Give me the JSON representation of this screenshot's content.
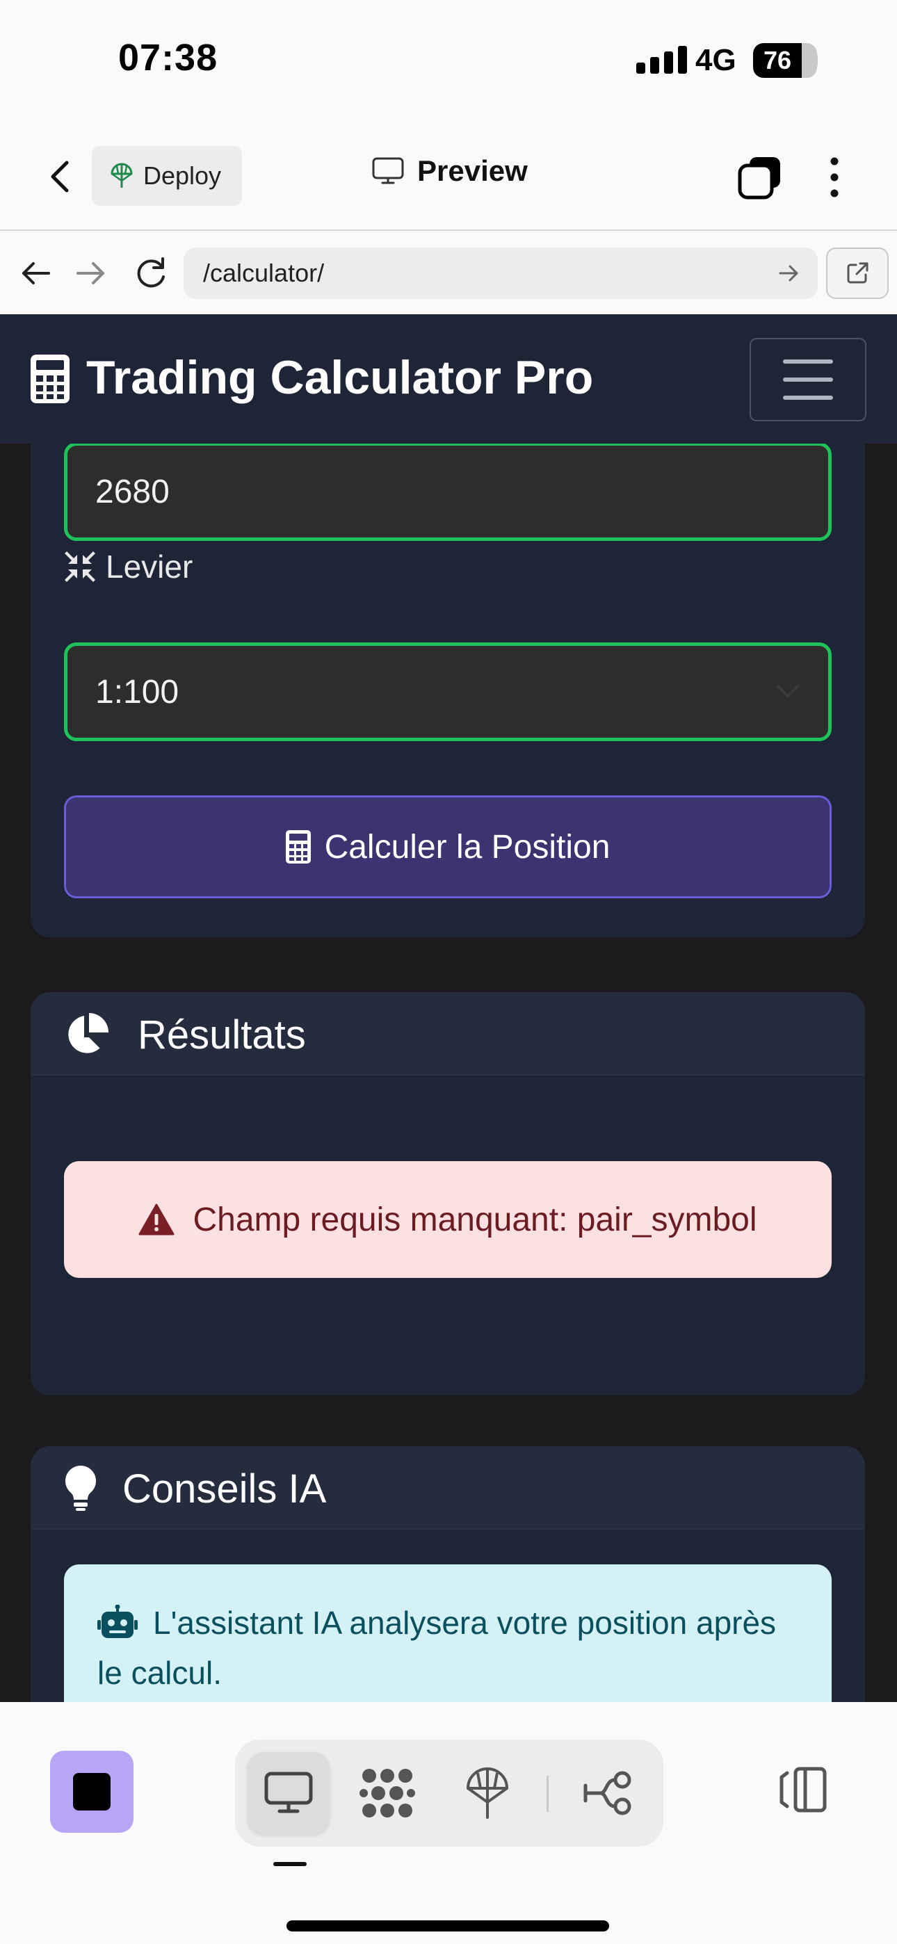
{
  "status_bar": {
    "time": "07:38",
    "network": "4G",
    "battery_percent": "76",
    "battery_level": 0.76
  },
  "app_header": {
    "deploy_label": "Deploy",
    "title": "Preview",
    "icons": [
      "back-chevron-icon",
      "deploy-icon",
      "monitor-icon",
      "tabs-icon",
      "more-vertical-icon"
    ]
  },
  "browser": {
    "url": "/calculator/",
    "icons": [
      "arrow-left-icon",
      "arrow-right-icon",
      "reload-icon",
      "arrow-right-icon",
      "open-external-icon"
    ]
  },
  "site": {
    "brand": "Trading Calculator Pro",
    "brand_icon": "calculator-icon",
    "form": {
      "price_value": "2680",
      "leverage_label": "Levier",
      "leverage_icon": "compress-icon",
      "leverage_value": "1:100",
      "submit_label": "Calculer la Position",
      "submit_icon": "calculator-icon"
    },
    "results": {
      "title": "Résultats",
      "icon": "pie-chart-icon",
      "error_text": "Champ requis manquant: pair_symbol",
      "error_icon": "warning-triangle-icon"
    },
    "advice": {
      "title": "Conseils IA",
      "icon": "lightbulb-icon",
      "info_text": "L'assistant IA analysera votre position après le calcul.",
      "info_icon": "robot-icon"
    }
  },
  "toolbar": {
    "items": [
      "stop-icon",
      "monitor-icon",
      "design-grid-icon",
      "deploy-icon",
      "workflow-icon",
      "panel-toggle-icon"
    ],
    "active": "monitor-icon"
  },
  "colors": {
    "page_bg": "#1b1b1d",
    "card_bg": "#1e2536",
    "card_header_bg": "#252c3e",
    "field_border": "#1fc25a",
    "button_bg": "#3b3470",
    "button_border": "#6a5cd8",
    "danger_bg": "#fde0e1",
    "danger_text": "#6b1b22",
    "info_bg": "#d4f1f5",
    "info_text": "#0a4f5d",
    "stop_bg": "#b8a5f7"
  }
}
